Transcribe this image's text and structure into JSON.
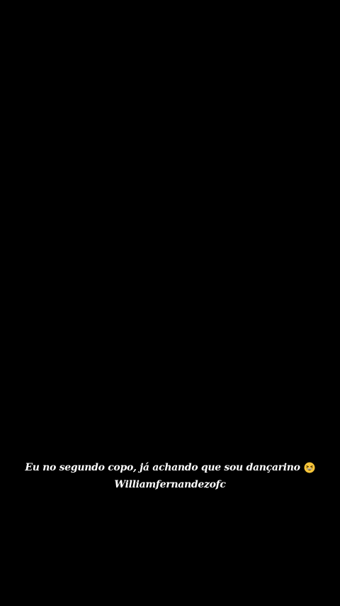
{
  "caption": {
    "text": "Eu no segundo copo, já achando que sou dançarino",
    "emoji": "grinning-squinting-face-icon"
  },
  "username": "Williamfernandezofc",
  "colors": {
    "background": "#000000",
    "text": "#ffffff",
    "emoji_face": "#f7c53a"
  }
}
